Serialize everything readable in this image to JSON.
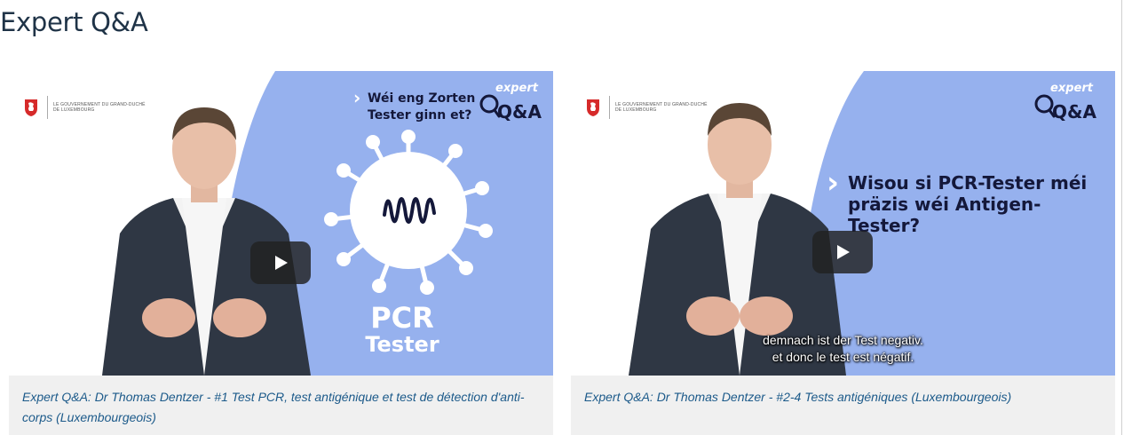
{
  "page": {
    "title": "Expert Q&A"
  },
  "cards": [
    {
      "gov_logo_text": "Le Gouvernement du Grand-Duché de Luxembourg",
      "expert_label": "expert",
      "qa_label": "Q&A",
      "question": "Wéi eng Zorten Tester ginn et?",
      "big_label_line1": "PCR",
      "big_label_line2": "Tester",
      "subtitle_lines": [],
      "caption": "Expert Q&A: Dr Thomas Dentzer - #1 Test PCR, test antigénique et test de détection d'anti-corps (Luxembourgeois)"
    },
    {
      "gov_logo_text": "Le Gouvernement du Grand-Duché de Luxembourg",
      "expert_label": "expert",
      "qa_label": "Q&A",
      "question": "Wisou si PCR-Tester méi präzis wéi Antigen-Tester?",
      "subtitle_lines": [
        "demnach ist der Test negativ.",
        "et donc le test est négatif."
      ],
      "caption": "Expert Q&A: Dr Thomas Dentzer - #2-4 Tests antigéniques (Luxembourgeois)"
    }
  ],
  "colors": {
    "brand_blue": "#96b1ee",
    "navy": "#14183a",
    "link": "#1c5a8a",
    "caption_bg": "#f0f0f0"
  },
  "icons": [
    "play-icon",
    "red-lion-icon",
    "chevron-right-icon",
    "virus-icon",
    "magnifier-icon"
  ]
}
